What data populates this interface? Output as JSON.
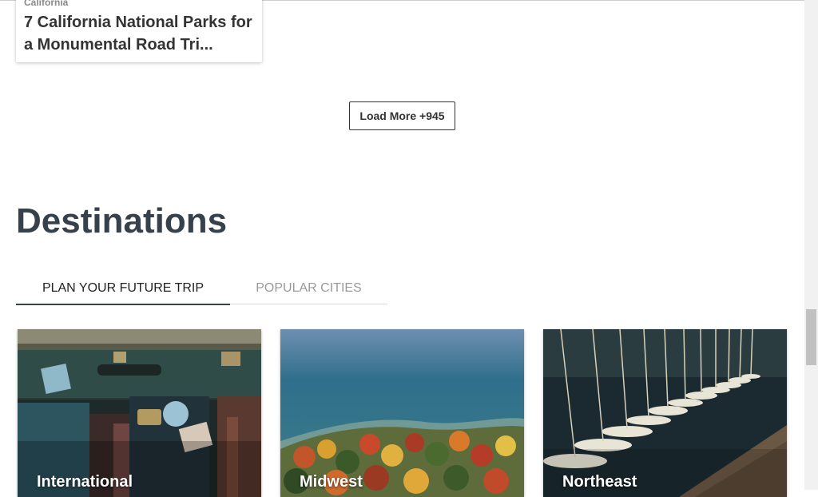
{
  "article": {
    "category": "California",
    "title": "7 California National Parks for a Monumental Road Tri..."
  },
  "load_more": {
    "label": "Load More +945"
  },
  "destinations": {
    "title": "Destinations",
    "tabs": [
      {
        "label": "PLAN YOUR FUTURE TRIP",
        "active": true
      },
      {
        "label": "POPULAR CITIES",
        "active": false
      }
    ],
    "cards": [
      {
        "label": "International"
      },
      {
        "label": "Midwest"
      },
      {
        "label": "Northeast"
      }
    ]
  },
  "colors": {
    "heading": "#37414b",
    "tab_active_underline": "#37414b",
    "tab_inactive_text": "#9a9a9a"
  }
}
